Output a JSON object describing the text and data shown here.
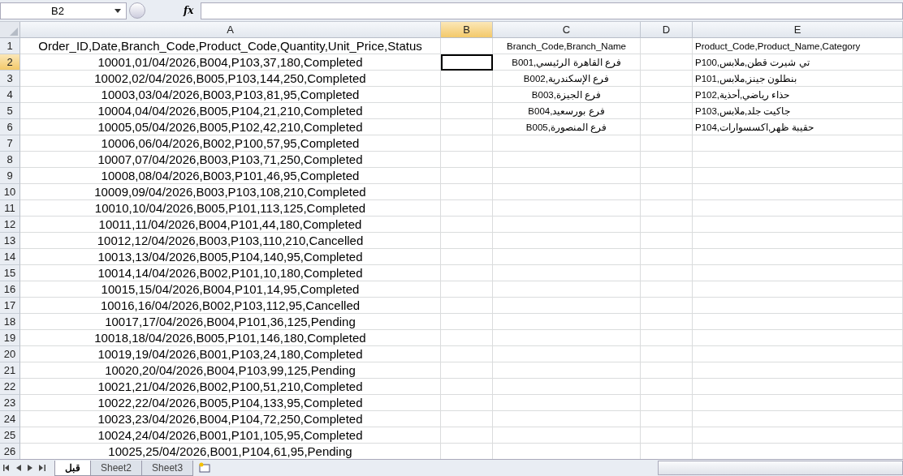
{
  "name_box": {
    "value": "B2"
  },
  "formula_bar": {
    "fx": "fx"
  },
  "columns": [
    {
      "label": "A",
      "selected": false
    },
    {
      "label": "B",
      "selected": true
    },
    {
      "label": "C",
      "selected": false
    },
    {
      "label": "D",
      "selected": false
    },
    {
      "label": "E",
      "selected": false
    }
  ],
  "rows": [
    {
      "number": "1",
      "selected": false,
      "cells": {
        "A": "Order_ID,Date,Branch_Code,Product_Code,Quantity,Unit_Price,Status",
        "C": "Branch_Code,Branch_Name",
        "E": "Product_Code,Product_Name,Category"
      }
    },
    {
      "number": "2",
      "selected": true,
      "cells": {
        "A": "10001,01/04/2026,B004,P103,37,180,Completed",
        "C": "B001,فرع القاهرة الرئيسي",
        "E": "P100,تي شيرت قطن,ملابس"
      }
    },
    {
      "number": "3",
      "selected": false,
      "cells": {
        "A": "10002,02/04/2026,B005,P103,144,250,Completed",
        "C": "B002,فرع الإسكندرية",
        "E": "P101,بنطلون جينز,ملابس"
      }
    },
    {
      "number": "4",
      "selected": false,
      "cells": {
        "A": "10003,03/04/2026,B003,P103,81,95,Completed",
        "C": "B003,فرع الجيزة",
        "E": "P102,حذاء رياضي,أحذية"
      }
    },
    {
      "number": "5",
      "selected": false,
      "cells": {
        "A": "10004,04/04/2026,B005,P104,21,210,Completed",
        "C": "B004,فرع بورسعيد",
        "E": "P103,جاكيت جلد,ملابس"
      }
    },
    {
      "number": "6",
      "selected": false,
      "cells": {
        "A": "10005,05/04/2026,B005,P102,42,210,Completed",
        "C": "B005,فرع المنصورة",
        "E": "P104,حقيبة ظهر,اكسسوارات"
      }
    },
    {
      "number": "7",
      "selected": false,
      "cells": {
        "A": "10006,06/04/2026,B002,P100,57,95,Completed"
      }
    },
    {
      "number": "8",
      "selected": false,
      "cells": {
        "A": "10007,07/04/2026,B003,P103,71,250,Completed"
      }
    },
    {
      "number": "9",
      "selected": false,
      "cells": {
        "A": "10008,08/04/2026,B003,P101,46,95,Completed"
      }
    },
    {
      "number": "10",
      "selected": false,
      "cells": {
        "A": "10009,09/04/2026,B003,P103,108,210,Completed"
      }
    },
    {
      "number": "11",
      "selected": false,
      "cells": {
        "A": "10010,10/04/2026,B005,P101,113,125,Completed"
      }
    },
    {
      "number": "12",
      "selected": false,
      "cells": {
        "A": "10011,11/04/2026,B004,P101,44,180,Completed"
      }
    },
    {
      "number": "13",
      "selected": false,
      "cells": {
        "A": "10012,12/04/2026,B003,P103,110,210,Cancelled"
      }
    },
    {
      "number": "14",
      "selected": false,
      "cells": {
        "A": "10013,13/04/2026,B005,P104,140,95,Completed"
      }
    },
    {
      "number": "15",
      "selected": false,
      "cells": {
        "A": "10014,14/04/2026,B002,P101,10,180,Completed"
      }
    },
    {
      "number": "16",
      "selected": false,
      "cells": {
        "A": "10015,15/04/2026,B004,P101,14,95,Completed"
      }
    },
    {
      "number": "17",
      "selected": false,
      "cells": {
        "A": "10016,16/04/2026,B002,P103,112,95,Cancelled"
      }
    },
    {
      "number": "18",
      "selected": false,
      "cells": {
        "A": "10017,17/04/2026,B004,P101,36,125,Pending"
      }
    },
    {
      "number": "19",
      "selected": false,
      "cells": {
        "A": "10018,18/04/2026,B005,P101,146,180,Completed"
      }
    },
    {
      "number": "20",
      "selected": false,
      "cells": {
        "A": "10019,19/04/2026,B001,P103,24,180,Completed"
      }
    },
    {
      "number": "21",
      "selected": false,
      "cells": {
        "A": "10020,20/04/2026,B004,P103,99,125,Pending"
      }
    },
    {
      "number": "22",
      "selected": false,
      "cells": {
        "A": "10021,21/04/2026,B002,P100,51,210,Completed"
      }
    },
    {
      "number": "23",
      "selected": false,
      "cells": {
        "A": "10022,22/04/2026,B005,P104,133,95,Completed"
      }
    },
    {
      "number": "24",
      "selected": false,
      "cells": {
        "A": "10023,23/04/2026,B004,P104,72,250,Completed"
      }
    },
    {
      "number": "25",
      "selected": false,
      "cells": {
        "A": "10024,24/04/2026,B001,P101,105,95,Completed"
      }
    },
    {
      "number": "26",
      "selected": false,
      "cells": {
        "A": "10025,25/04/2026,B001,P104,61,95,Pending"
      }
    }
  ],
  "sheet_tabs": [
    {
      "label": "قبل",
      "selected": true
    },
    {
      "label": "Sheet2",
      "selected": false
    },
    {
      "label": "Sheet3",
      "selected": false
    }
  ]
}
